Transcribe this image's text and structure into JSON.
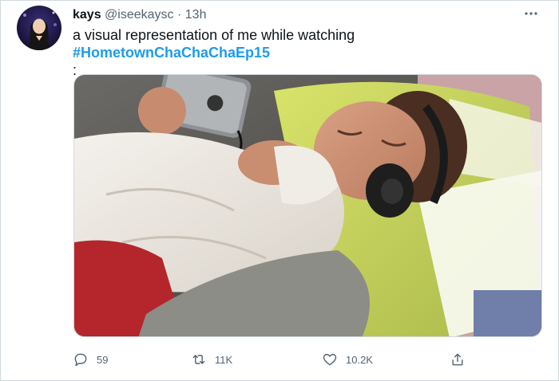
{
  "tweet": {
    "author_name": "kays",
    "author_handle": "@iseekaysc",
    "separator": "·",
    "time": "13h",
    "text_before": "a visual representation of me while watching ",
    "hashtag": "#HometownChaChaChaEp15",
    "text_after": ":"
  },
  "actions": {
    "reply_count": "59",
    "retweet_count": "11K",
    "like_count": "10.2K"
  },
  "icons": {
    "more": "more-icon",
    "reply": "reply-icon",
    "retweet": "retweet-icon",
    "like": "like-icon",
    "share": "share-icon"
  },
  "colors": {
    "text": "#0f1419",
    "secondary": "#536471",
    "hashtag": "#1d9bf0",
    "border": "#cfd9de"
  }
}
